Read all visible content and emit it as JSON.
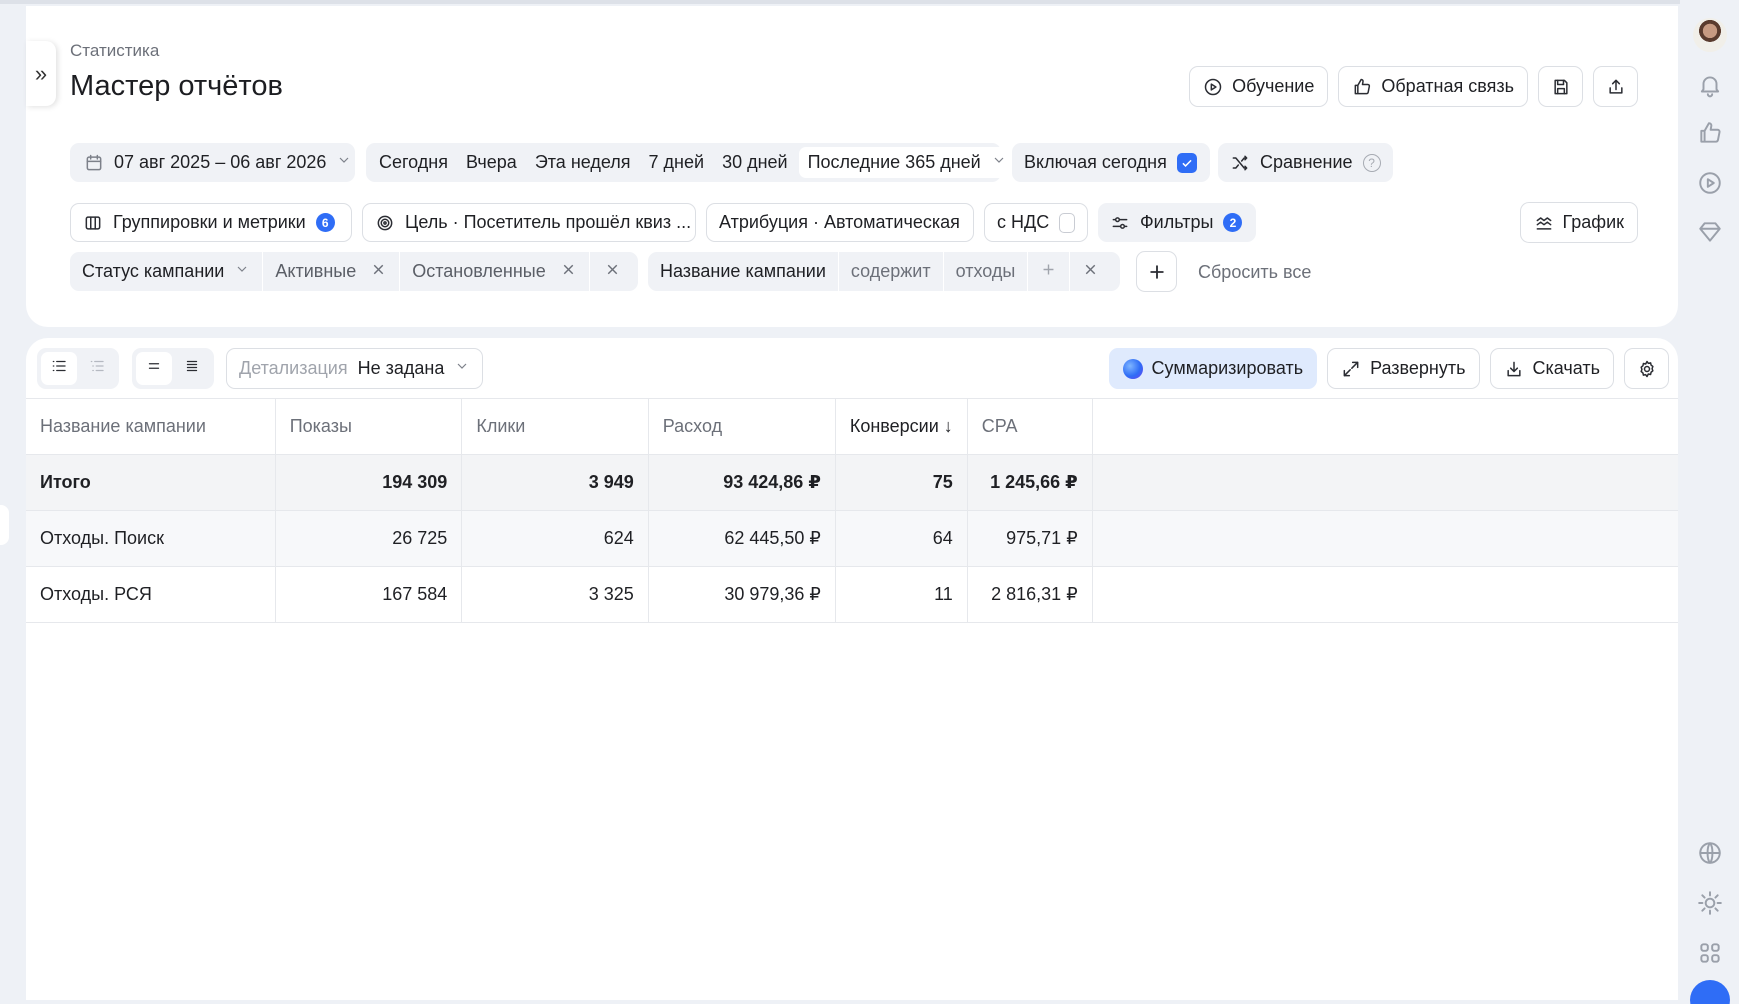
{
  "header": {
    "breadcrumb": "Статистика",
    "title": "Мастер отчётов",
    "actions": {
      "learning": "Обучение",
      "feedback": "Обратная связь"
    }
  },
  "period": {
    "range": "07 авг 2025 – 06 авг 2026",
    "presets": [
      "Сегодня",
      "Вчера",
      "Эта неделя",
      "7 дней",
      "30 дней"
    ],
    "selected": "Последние 365 дней",
    "include_today": "Включая сегодня",
    "include_today_checked": true,
    "compare": "Сравнение",
    "help": "?"
  },
  "settings": {
    "groupings": "Группировки и метрики",
    "groupings_count": "6",
    "goal": "Цель · Посетитель прошёл квиз ...",
    "attribution": "Атрибуция · Автоматическая",
    "vat": "с НДС",
    "vat_checked": false,
    "filters": "Фильтры",
    "filters_count": "2",
    "chart": "График"
  },
  "filter_row": {
    "status_label": "Статус кампании",
    "status_values": [
      "Активные",
      "Остановленные"
    ],
    "name_label": "Название кампании",
    "name_operator": "содержит",
    "name_value": "отходы",
    "reset": "Сбросить все"
  },
  "toolbar": {
    "detail_label": "Детализация",
    "detail_value": "Не задана",
    "summarize": "Суммаризировать",
    "expand": "Развернуть",
    "download": "Скачать"
  },
  "table": {
    "columns": [
      "Название кампании",
      "Показы",
      "Клики",
      "Расход",
      "Конверсии ↓",
      "CPA"
    ],
    "total": [
      "Итого",
      "194 309",
      "3 949",
      "93 424,86 ₽",
      "75",
      "1 245,66 ₽"
    ],
    "rows": [
      [
        "Отходы. Поиск",
        "26 725",
        "624",
        "62 445,50 ₽",
        "64",
        "975,71 ₽"
      ],
      [
        "Отходы. РСЯ",
        "167 584",
        "3 325",
        "30 979,36 ₽",
        "11",
        "2 816,31 ₽"
      ]
    ]
  },
  "rail_icons": [
    "bell-icon",
    "thumbs-up-icon",
    "play-icon",
    "diamond-icon",
    "globe-icon",
    "sun-icon",
    "apps-grid-icon"
  ]
}
